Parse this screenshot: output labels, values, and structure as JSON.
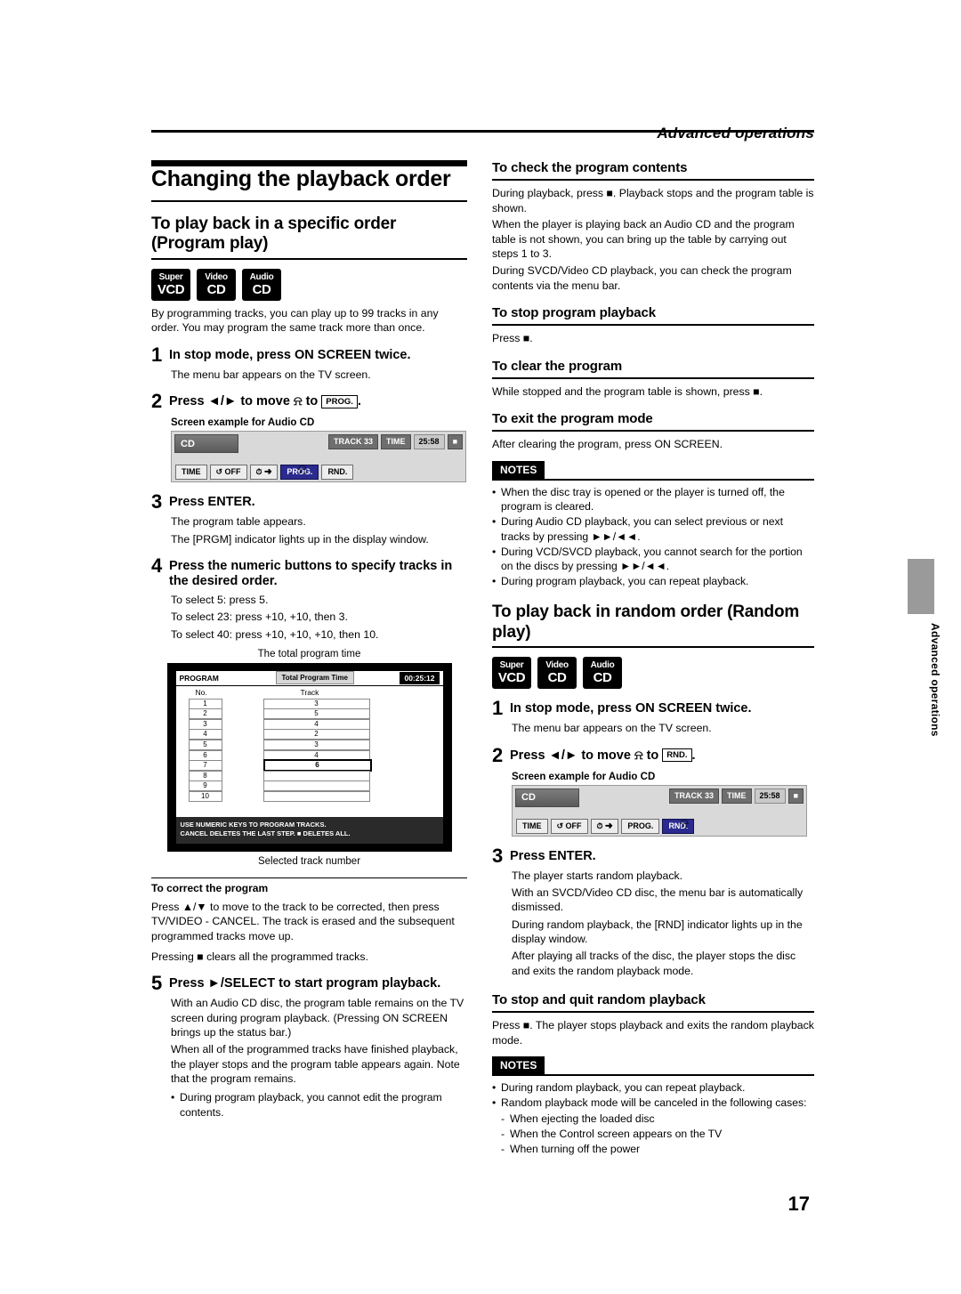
{
  "header": {
    "title": "Advanced operations"
  },
  "page_number": "17",
  "side_tab_text": "Advanced operations",
  "left": {
    "h1": "Changing the playback order",
    "h2": "To play back in a specific order (Program play)",
    "logos": [
      {
        "line1": "Super",
        "line2": "VCD"
      },
      {
        "line1": "Video",
        "line2": "CD"
      },
      {
        "line1": "Audio",
        "line2": "CD"
      }
    ],
    "intro": "By programming tracks, you can play up to 99 tracks in any order. You may program the same track more than once.",
    "steps": [
      {
        "num": "1",
        "title": "In stop mode, press ON SCREEN twice.",
        "body": [
          "The menu bar appears on the TV screen."
        ]
      },
      {
        "num": "2",
        "title_pre": "Press",
        "title_arrows": "◄/►",
        "title_mid": "to move",
        "title_to": "to",
        "title_key": "PROG.",
        "title_end": ".",
        "caption": "Screen example for Audio CD"
      },
      {
        "num": "3",
        "title": "Press ENTER.",
        "body": [
          "The program table appears.",
          "The [PRGM] indicator lights up in the display window."
        ]
      },
      {
        "num": "4",
        "title": "Press the numeric buttons to specify tracks in the desired order.",
        "body": [
          "To select 5: press 5.",
          "To select 23: press +10, +10, then 3.",
          "To select 40: press +10, +10, +10, then 10."
        ]
      },
      {
        "num": "5",
        "title": "Press ►/SELECT to start program playback.",
        "body": [
          "With an Audio CD disc, the program table remains on the TV screen during program playback. (Pressing ON SCREEN brings up the status bar.)",
          "When all of the programmed tracks have finished playback, the player stops and the program table appears again. Note that the program remains."
        ],
        "bullets": [
          "During program playback, you cannot edit the program contents."
        ]
      }
    ],
    "osd": {
      "label_cd": "CD",
      "chips_right": [
        {
          "text": "TRACK 33",
          "light": false
        },
        {
          "text": "TIME",
          "light": false
        },
        {
          "text": "25:58",
          "light": true
        },
        {
          "text": "■",
          "light": false
        }
      ],
      "buttons": [
        "TIME",
        "↺ OFF",
        "⏱ ➜",
        "PROG.",
        "RND."
      ],
      "selected_button": "PROG."
    },
    "figure": {
      "top_caption": "The total program time",
      "bottom_caption": "Selected track number",
      "program_label": "PROGRAM",
      "total_label": "Total Program Time",
      "total_time": "00:25:12",
      "col_no": "No.",
      "col_track": "Track",
      "rows": [
        {
          "idx": "1",
          "track": "3"
        },
        {
          "idx": "2",
          "track": "5"
        },
        {
          "idx": "3",
          "track": "4"
        },
        {
          "idx": "4",
          "track": "2"
        },
        {
          "idx": "5",
          "track": "3"
        },
        {
          "idx": "6",
          "track": "4"
        },
        {
          "idx": "7",
          "track": "6",
          "highlight": true
        },
        {
          "idx": "8",
          "track": ""
        },
        {
          "idx": "9",
          "track": ""
        },
        {
          "idx": "10",
          "track": ""
        }
      ],
      "note_line1": "USE NUMERIC KEYS  TO PROGRAM TRACKS.",
      "note_line2": "CANCEL DELETES THE LAST STEP. ■ DELETES ALL."
    },
    "correct": {
      "title": "To correct the program",
      "body": [
        "Press ▲/▼ to move      to the track to be corrected, then press TV/VIDEO - CANCEL. The track is erased and the subsequent programmed tracks move up.",
        "Pressing ■ clears all the programmed tracks."
      ]
    }
  },
  "right": {
    "sections": [
      {
        "title": "To check the program contents",
        "body": [
          "During playback, press ■. Playback stops and the program table is shown.",
          "When the player is playing back an Audio CD and the program table is not shown, you can bring up the table by carrying out steps 1 to 3.",
          "During SVCD/Video CD playback, you can check the program contents via the menu bar."
        ]
      },
      {
        "title": "To stop program playback",
        "body": [
          "Press ■."
        ]
      },
      {
        "title": "To clear the program",
        "body": [
          "While stopped and the program table is shown, press ■."
        ]
      },
      {
        "title": "To exit the program mode",
        "body": [
          "After clearing the program, press ON SCREEN."
        ]
      }
    ],
    "notes1": {
      "tag": "NOTES",
      "items": [
        "When the disc tray is opened or the player is turned off, the program is cleared.",
        "During Audio CD playback, you can select previous or next tracks by pressing ►►/◄◄.",
        "During VCD/SVCD playback, you cannot search for the portion on the discs by pressing ►►/◄◄.",
        "During program playback, you can repeat playback."
      ]
    },
    "h2_random": "To play back in random order (Random play)",
    "logos": [
      {
        "line1": "Super",
        "line2": "VCD"
      },
      {
        "line1": "Video",
        "line2": "CD"
      },
      {
        "line1": "Audio",
        "line2": "CD"
      }
    ],
    "steps": [
      {
        "num": "1",
        "title": "In stop mode, press ON SCREEN twice.",
        "body": [
          "The menu bar appears on the TV screen."
        ]
      },
      {
        "num": "2",
        "title_pre": "Press",
        "title_arrows": "◄/►",
        "title_mid": "to move",
        "title_to": "to",
        "title_key": "RND.",
        "title_end": ".",
        "caption": "Screen example for Audio CD"
      },
      {
        "num": "3",
        "title": "Press ENTER.",
        "body": [
          "The player starts random playback.",
          "With an SVCD/Video CD disc, the menu bar is automatically dismissed.",
          "During random playback, the [RND] indicator lights up in the display window.",
          "After playing all tracks of the disc, the player stops the disc and exits the random playback mode."
        ]
      }
    ],
    "osd": {
      "label_cd": "CD",
      "chips_right": [
        {
          "text": "TRACK 33",
          "light": false
        },
        {
          "text": "TIME",
          "light": false
        },
        {
          "text": "25:58",
          "light": true
        },
        {
          "text": "■",
          "light": false
        }
      ],
      "buttons": [
        "TIME",
        "↺ OFF",
        "⏱ ➜",
        "PROG.",
        "RND."
      ],
      "selected_button": "RND."
    },
    "stop_random": {
      "title": "To stop and quit random playback",
      "body": [
        "Press ■. The player stops playback and exits the random playback mode."
      ]
    },
    "notes2": {
      "tag": "NOTES",
      "items": [
        {
          "text": "During random playback, you can repeat playback.",
          "dash": false
        },
        {
          "text": "Random playback mode will be canceled in the following cases:",
          "dash": false
        },
        {
          "text": "When ejecting the loaded disc",
          "dash": true
        },
        {
          "text": "When the Control screen appears on the TV",
          "dash": true
        },
        {
          "text": "When turning off the power",
          "dash": true
        }
      ]
    }
  }
}
